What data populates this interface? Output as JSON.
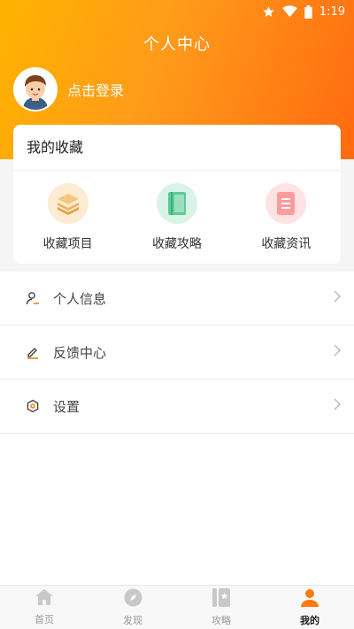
{
  "status_bar": {
    "time": "1:19"
  },
  "header": {
    "title": "个人中心",
    "login_text": "点击登录"
  },
  "favorites": {
    "title": "我的收藏",
    "items": [
      {
        "label": "收藏项目",
        "icon": "stack-layers-icon",
        "color": "#f3b35b"
      },
      {
        "label": "收藏攻略",
        "icon": "book-icon",
        "color": "#4fc08d"
      },
      {
        "label": "收藏资讯",
        "icon": "document-icon",
        "color": "#ff7b7b"
      }
    ]
  },
  "menu": [
    {
      "label": "个人信息",
      "icon": "user-icon"
    },
    {
      "label": "反馈中心",
      "icon": "edit-icon"
    },
    {
      "label": "设置",
      "icon": "settings-icon"
    }
  ],
  "bottom_nav": [
    {
      "label": "首页",
      "icon": "home-icon"
    },
    {
      "label": "发现",
      "icon": "compass-icon"
    },
    {
      "label": "攻略",
      "icon": "guide-icon"
    },
    {
      "label": "我的",
      "icon": "profile-icon",
      "active": true
    }
  ],
  "colors": {
    "accent": "#ff7a10",
    "header_start": "#ffb300",
    "header_end": "#ff6a10"
  }
}
